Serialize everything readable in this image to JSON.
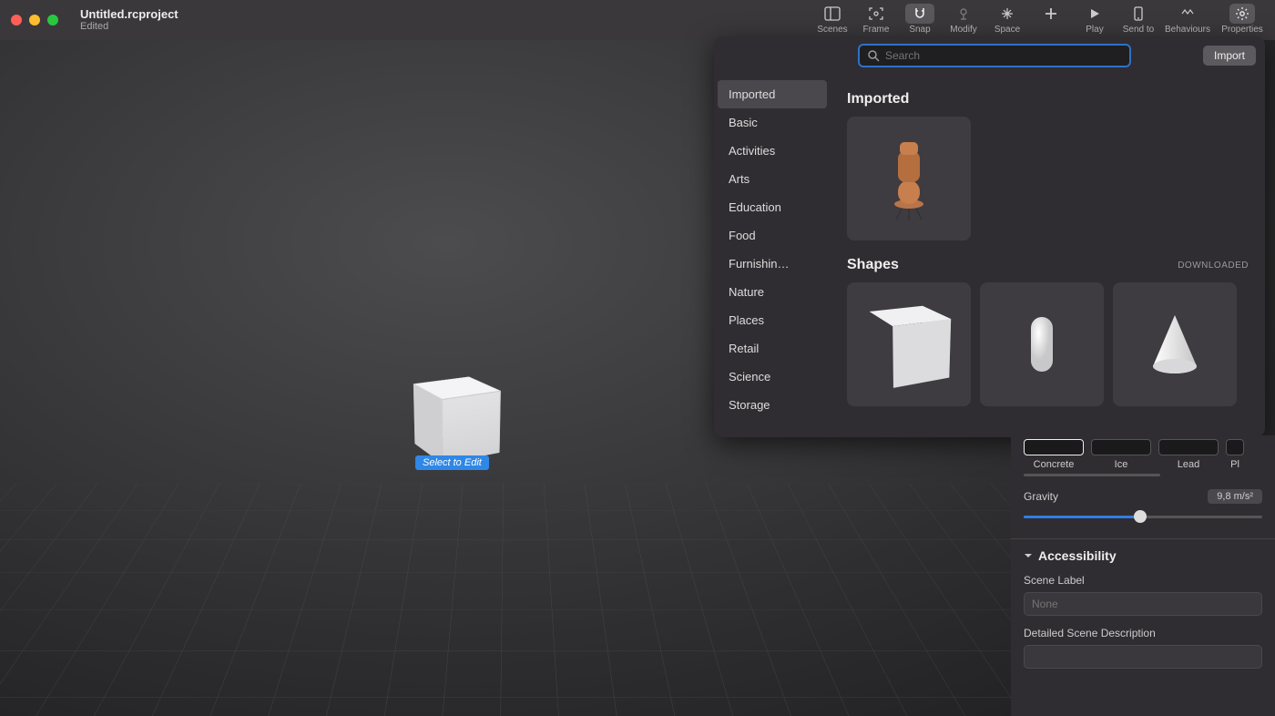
{
  "title": {
    "filename": "Untitled.rcproject",
    "status": "Edited"
  },
  "toolbar": {
    "scenes": "Scenes",
    "frame": "Frame",
    "snap": "Snap",
    "modify": "Modify",
    "space": "Space",
    "add": "",
    "play": "Play",
    "sendto": "Send to",
    "behaviours": "Behaviours",
    "properties": "Properties"
  },
  "viewport": {
    "select_badge": "Select to Edit"
  },
  "asset_panel": {
    "search_placeholder": "Search",
    "import_btn": "Import",
    "categories": [
      "Imported",
      "Basic",
      "Activities",
      "Arts",
      "Education",
      "Food",
      "Furnishin…",
      "Nature",
      "Places",
      "Retail",
      "Science",
      "Storage"
    ],
    "selected_category_index": 0,
    "sections": {
      "imported": {
        "title": "Imported"
      },
      "shapes": {
        "title": "Shapes",
        "tag": "DOWNLOADED"
      }
    }
  },
  "props": {
    "materials": [
      "Concrete",
      "Ice",
      "Lead",
      "Pl"
    ],
    "selected_material_index": 0,
    "gravity_label": "Gravity",
    "gravity_value": "9,8 m/s²",
    "accessibility": {
      "header": "Accessibility",
      "scene_label": "Scene Label",
      "scene_label_placeholder": "None",
      "detailed_label": "Detailed Scene Description"
    }
  }
}
